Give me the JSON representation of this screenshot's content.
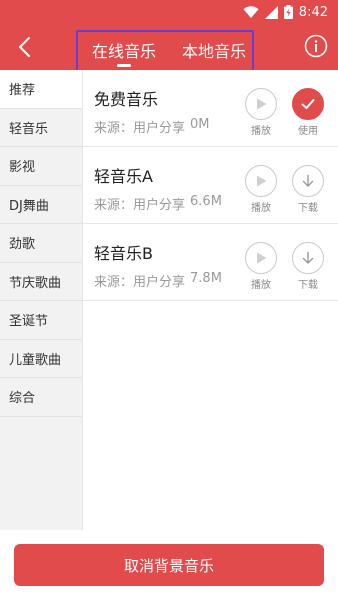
{
  "status_bar": {
    "time": "8:42"
  },
  "header": {
    "tabs": [
      {
        "label": "在线音乐",
        "active": true
      },
      {
        "label": "本地音乐",
        "active": false
      }
    ],
    "accent_color": "#e24b4b"
  },
  "sidebar": {
    "items": [
      {
        "label": "推荐",
        "active": true
      },
      {
        "label": "轻音乐",
        "active": false
      },
      {
        "label": "影视",
        "active": false
      },
      {
        "label": "DJ舞曲",
        "active": false
      },
      {
        "label": "劲歌",
        "active": false
      },
      {
        "label": "节庆歌曲",
        "active": false
      },
      {
        "label": "圣诞节",
        "active": false
      },
      {
        "label": "儿童歌曲",
        "active": false
      },
      {
        "label": "综合",
        "active": false
      }
    ]
  },
  "music_list": [
    {
      "title": "免费音乐",
      "source_label": "来源：用户分享",
      "size": "0M",
      "play_label": "播放",
      "action_label": "使用",
      "action_icon": "check-icon",
      "in_use": true
    },
    {
      "title": "轻音乐A",
      "source_label": "来源：用户分享",
      "size": "6.6M",
      "play_label": "播放",
      "action_label": "下载",
      "action_icon": "download-icon",
      "in_use": false
    },
    {
      "title": "轻音乐B",
      "source_label": "来源：用户分享",
      "size": "7.8M",
      "play_label": "播放",
      "action_label": "下载",
      "action_icon": "download-icon",
      "in_use": false
    }
  ],
  "bottom": {
    "cancel_label": "取消背景音乐"
  }
}
